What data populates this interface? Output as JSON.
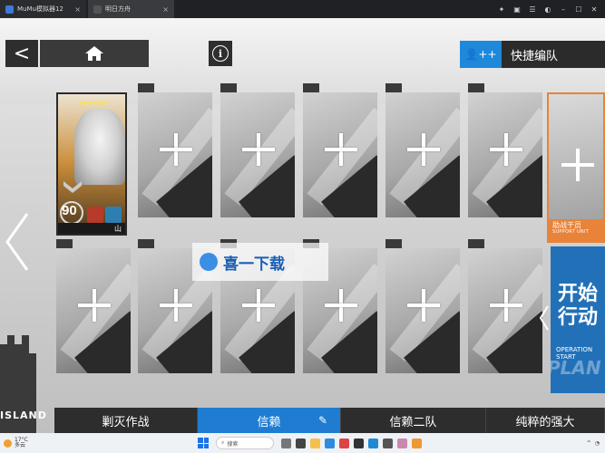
{
  "window": {
    "tabs": [
      {
        "label": "MuMu模拟器12",
        "close": "×"
      },
      {
        "label": "明日方舟",
        "close": "×"
      }
    ],
    "icons": [
      "wifi-icon",
      "gift-icon",
      "menu-icon",
      "speaker-icon",
      "minimize-icon",
      "maximize-icon",
      "close-icon"
    ],
    "icon_glyphs": [
      "✦",
      "▣",
      "☰",
      "◐",
      "–",
      "☐",
      "✕"
    ]
  },
  "game": {
    "back_label": "<",
    "info_label": "i",
    "quick_formation_label": "快捷编队",
    "quick_formation_icon": "👤++",
    "operator": {
      "level": "90",
      "stars": "★★★★★★",
      "class_label": "山"
    },
    "support": {
      "label": "助战干员",
      "sub_label": "SUPPORT UNIT"
    },
    "start": {
      "label": "开始\n行动",
      "sub_label": "OPERATION START",
      "bg_text": "PLAN"
    },
    "island_text": "ISLAND",
    "watermark": "喜一下载",
    "squads": [
      {
        "label": "剿灭作战",
        "active": false
      },
      {
        "label": "信赖",
        "active": true
      },
      {
        "label": "信赖二队",
        "active": false
      },
      {
        "label": "纯粹的强大",
        "active": false
      }
    ],
    "edit_icon": "✎"
  },
  "taskbar": {
    "temp": "17°C",
    "weather_desc": "多云",
    "search_placeholder": "搜索"
  },
  "colors": {
    "accent_blue": "#1f7cd1",
    "support_orange": "#e8833a"
  }
}
